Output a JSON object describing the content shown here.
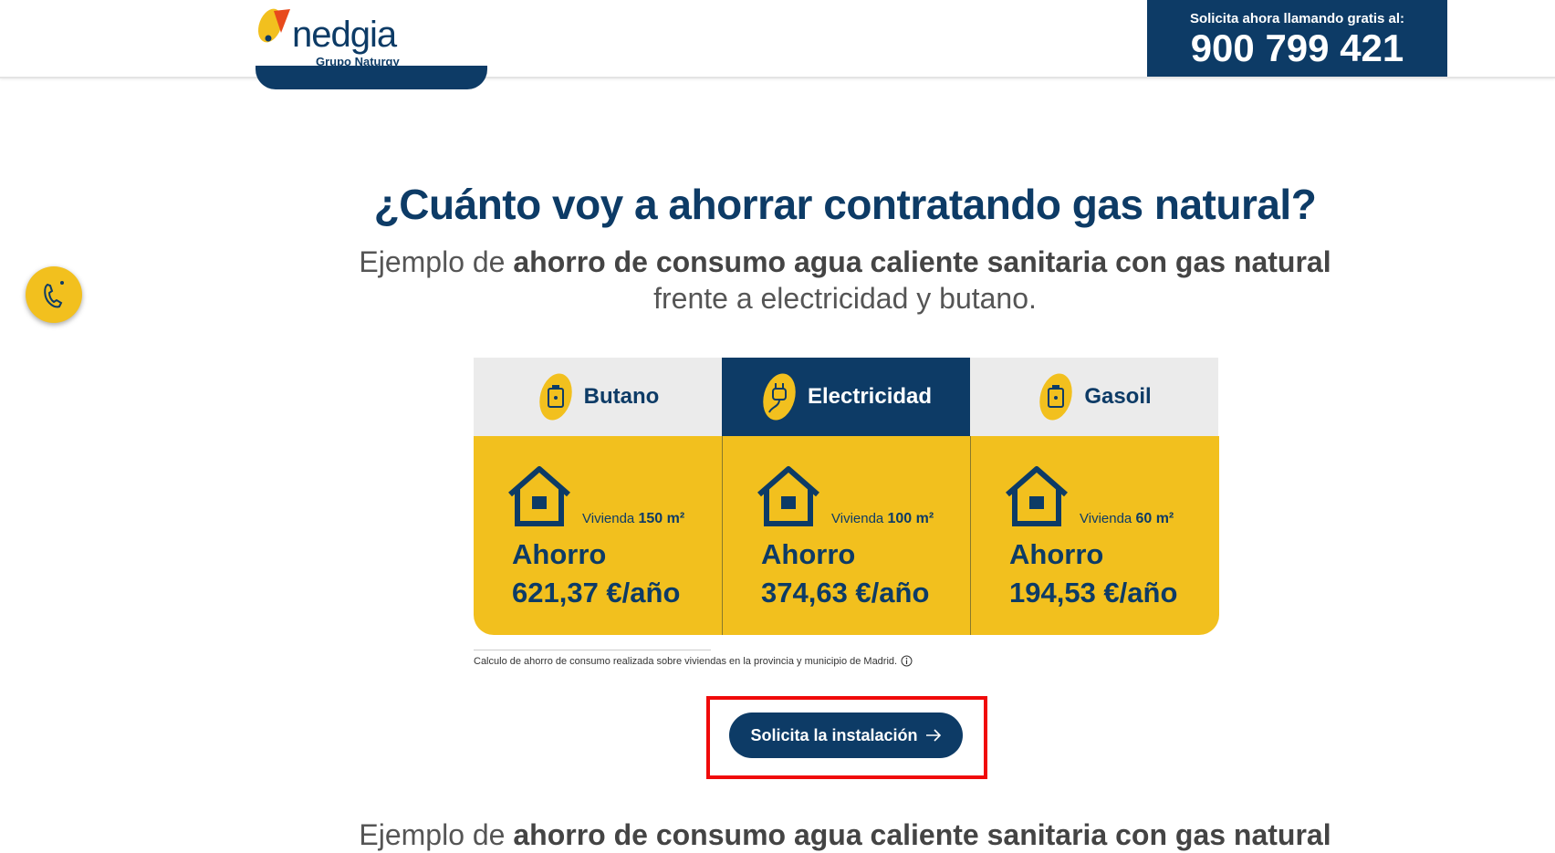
{
  "header": {
    "logo_text": "nedgia",
    "logo_subtext": "Grupo Naturgy",
    "call_label": "Solicita ahora llamando gratis al:",
    "call_number": "900 799 421"
  },
  "main": {
    "title": "¿Cuánto voy a ahorrar contratando gas natural?",
    "subtitle_pre": "Ejemplo de ",
    "subtitle_bold": "ahorro de consumo agua caliente sanitaria con gas natural",
    "subtitle_post": "frente a electricidad y butano.",
    "columns": [
      {
        "fuel": "Butano",
        "icon": "gas-bottle-icon",
        "vivienda_label": "Vivienda",
        "size": "150 m²",
        "ahorro_label": "Ahorro",
        "amount": "621,37 €/año"
      },
      {
        "fuel": "Electricidad",
        "icon": "electric-plug-icon",
        "vivienda_label": "Vivienda",
        "size": "100 m²",
        "ahorro_label": "Ahorro",
        "amount": "374,63 €/año"
      },
      {
        "fuel": "Gasoil",
        "icon": "gas-bottle-icon",
        "vivienda_label": "Vivienda",
        "size": "60 m²",
        "ahorro_label": "Ahorro",
        "amount": "194,53 €/año"
      }
    ],
    "footnote": "Calculo de ahorro de consumo realizada sobre viviendas en la provincia y municipio de Madrid.",
    "cta_label": "Solicita la instalación",
    "subtitle2_pre": "Ejemplo de ",
    "subtitle2_bold": "ahorro de consumo agua caliente sanitaria con gas natural"
  },
  "colors": {
    "navy": "#0d3b66",
    "yellow": "#f2c01e",
    "highlight_outline": "#f00a0a"
  }
}
